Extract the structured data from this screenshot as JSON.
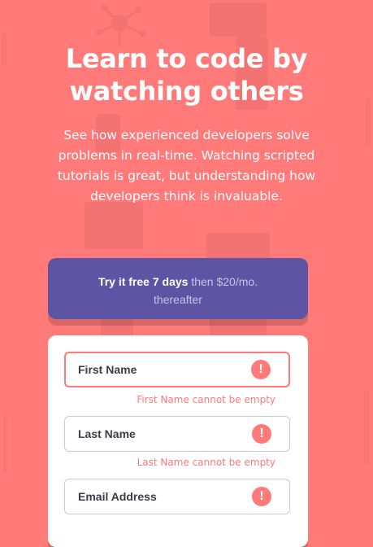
{
  "hero": {
    "headline": "Learn to code by watching others",
    "subcopy": "See how experienced developers solve problems in real-time. Watching scripted tutorials is great, but understanding how developers think is invaluable."
  },
  "promo": {
    "bold": "Try it free 7 days",
    "muted": "then $20/mo.",
    "line2": "thereafter"
  },
  "form": {
    "fields": [
      {
        "label": "First Name",
        "error": "First Name cannot be empty",
        "icon": "!"
      },
      {
        "label": "Last Name",
        "error": "Last Name cannot be empty",
        "icon": "!"
      },
      {
        "label": "Email Address",
        "icon": "!"
      }
    ]
  },
  "colors": {
    "background": "#ff7a79",
    "accent_purple": "#5e54a4",
    "error_red": "#ff7a79"
  }
}
